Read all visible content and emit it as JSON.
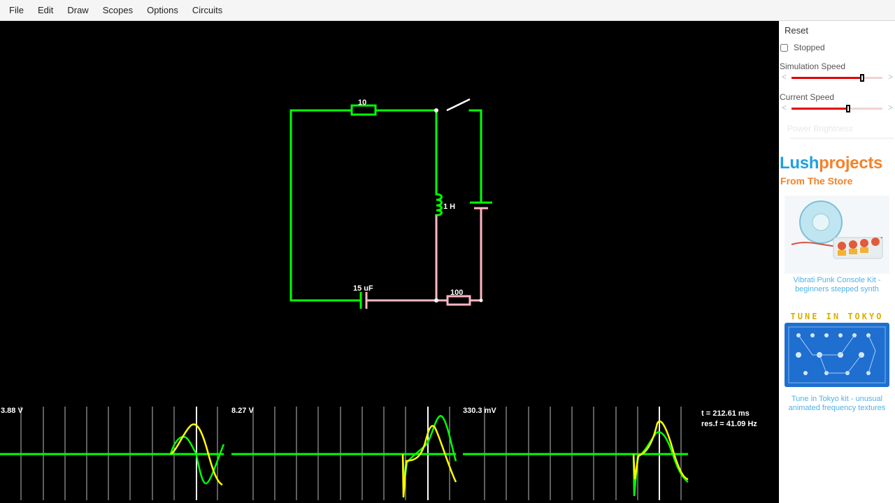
{
  "menu": [
    "File",
    "Edit",
    "Draw",
    "Scopes",
    "Options",
    "Circuits"
  ],
  "sidebar": {
    "reset_label": "Reset",
    "stopped_label": "Stopped",
    "sim_speed_label": "Simulation Speed",
    "current_speed_label": "Current Speed",
    "power_brightness_label": "Power Brightness",
    "sim_speed_value": 0.78,
    "current_speed_value": 0.62
  },
  "ad": {
    "brand_part1": "Lush",
    "brand_part2": "projects",
    "store_heading": "From The Store",
    "product1_caption": "Vibrati Punk Console Kit - beginners stepped synth",
    "product2_title": "TUNE IN TOKYO",
    "product2_caption": "Tune in Tokyo kit - unusual animated frequency textures"
  },
  "circuit": {
    "resistor_top_label": "10",
    "inductor_label": "1 H",
    "capacitor_label": "15 uF",
    "resistor_bottom_label": "100"
  },
  "scopes": {
    "scope1_value": "3.88 V",
    "scope2_value": "8.27 V",
    "scope3_value": "330.3 mV"
  },
  "info": {
    "time": "t = 212.61 ms",
    "resf": "res.f = 41.09 Hz"
  },
  "colors": {
    "wire_active": "#00ff00",
    "wire_low": "#ffb6c1",
    "trace_voltage": "#00ff00",
    "trace_current": "#ffff00",
    "slider_fill": "#e20000"
  }
}
